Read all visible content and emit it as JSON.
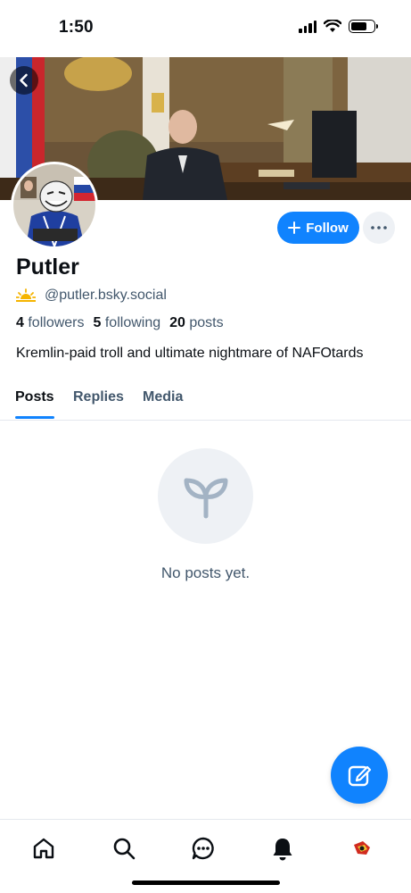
{
  "status_bar": {
    "time": "1:50"
  },
  "profile": {
    "display_name": "Putler",
    "handle": "@putler.bsky.social",
    "bio": "Kremlin-paid troll and ultimate nightmare of NAFOtards",
    "stats": {
      "followers_count": "4",
      "followers_label": "followers",
      "following_count": "5",
      "following_label": "following",
      "posts_count": "20",
      "posts_label": "posts"
    }
  },
  "actions": {
    "follow_label": "Follow"
  },
  "tabs": [
    {
      "label": "Posts",
      "active": true
    },
    {
      "label": "Replies",
      "active": false
    },
    {
      "label": "Media",
      "active": false
    }
  ],
  "feed": {
    "empty_message": "No posts yet."
  },
  "icons": {
    "back": "chevron-left-icon",
    "follow": "plus-icon",
    "more": "ellipsis-icon",
    "empty": "sprout-icon",
    "compose": "compose-icon",
    "nav": [
      "home-icon",
      "search-icon",
      "chat-icon",
      "bell-icon",
      "profile-avatar"
    ]
  },
  "colors": {
    "accent": "#1083fe",
    "secondary_text": "#42576c",
    "muted_background": "#eef1f5"
  }
}
